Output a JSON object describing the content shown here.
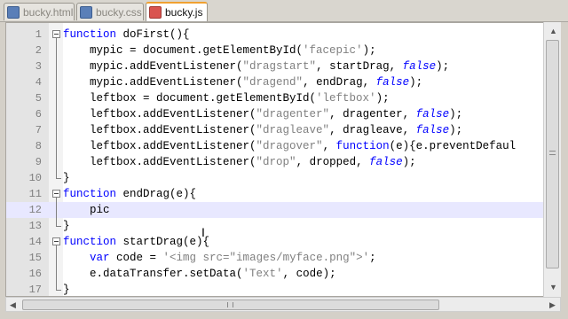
{
  "tabs": [
    {
      "label": "bucky.html",
      "state": "saved",
      "active": false
    },
    {
      "label": "bucky.css",
      "state": "saved",
      "active": false
    },
    {
      "label": "bucky.js",
      "state": "unsaved",
      "active": true
    }
  ],
  "editor": {
    "current_line": 12,
    "lines": [
      {
        "n": "1",
        "t": "function doFirst(){"
      },
      {
        "n": "2",
        "t": "    mypic = document.getElementById('facepic');"
      },
      {
        "n": "3",
        "t": "    mypic.addEventListener(\"dragstart\", startDrag, false);"
      },
      {
        "n": "4",
        "t": "    mypic.addEventListener(\"dragend\", endDrag, false);"
      },
      {
        "n": "5",
        "t": "    leftbox = document.getElementById('leftbox');"
      },
      {
        "n": "6",
        "t": "    leftbox.addEventListener(\"dragenter\", dragenter, false);"
      },
      {
        "n": "7",
        "t": "    leftbox.addEventListener(\"dragleave\", dragleave, false);"
      },
      {
        "n": "8",
        "t": "    leftbox.addEventListener(\"dragover\", function(e){e.preventDefaul"
      },
      {
        "n": "9",
        "t": "    leftbox.addEventListener(\"drop\", dropped, false);"
      },
      {
        "n": "10",
        "t": "}"
      },
      {
        "n": "11",
        "t": "function endDrag(e){"
      },
      {
        "n": "12",
        "t": "    pic"
      },
      {
        "n": "13",
        "t": "}"
      },
      {
        "n": "14",
        "t": "function startDrag(e){"
      },
      {
        "n": "15",
        "t": "    var code = '<img src=\"images/myface.png\">';"
      },
      {
        "n": "16",
        "t": "    e.dataTransfer.setData('Text', code);"
      },
      {
        "n": "17",
        "t": "}"
      }
    ]
  },
  "colors": {
    "keyword": "#0000ff",
    "string": "#808080",
    "current_line": "#e8e8ff",
    "active_tab_accent": "#f0a030"
  }
}
